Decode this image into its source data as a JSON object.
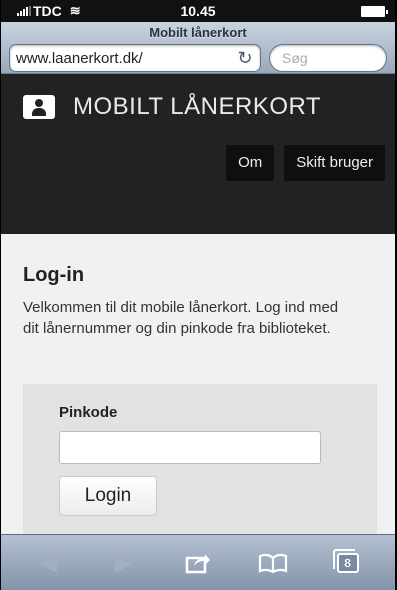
{
  "status": {
    "carrier": "TDC",
    "time": "10.45"
  },
  "safari": {
    "title": "Mobilt lånerkort",
    "url": "www.laanerkort.dk/",
    "search_placeholder": "Søg"
  },
  "site": {
    "brand": "MOBILT LÅNERKORT",
    "nav": [
      {
        "label": "Om"
      },
      {
        "label": "Skift bruger"
      }
    ]
  },
  "login": {
    "heading": "Log-in",
    "intro": "Velkommen til dit mobile lånerkort. Log ind med dit lånernummer og din pinkode fra biblioteket.",
    "pin_label": "Pinkode",
    "pin_value": "",
    "button": "Login"
  },
  "toolbar": {
    "tab_count": "8"
  },
  "icons": {
    "back": "back-arrow-icon",
    "forward": "forward-arrow-icon",
    "share": "share-icon",
    "bookmarks": "bookmarks-icon",
    "tabs": "tabs-icon",
    "reload": "reload-icon"
  }
}
